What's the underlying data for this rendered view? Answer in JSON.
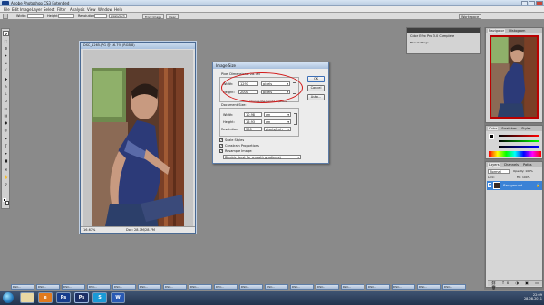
{
  "app": {
    "title": "Adobe Photoshop CS3 Extended"
  },
  "menu": [
    "File",
    "Edit",
    "Image",
    "Layer",
    "Select",
    "Filter",
    "Analysis",
    "View",
    "Window",
    "Help"
  ],
  "options": {
    "width_label": "Width:",
    "height_label": "Height:",
    "resolution_label": "Resolution:",
    "resolution_unit": "pixels/inch",
    "front_image": "Front Image",
    "clear": "Clear",
    "workspace": "Workspace"
  },
  "document": {
    "title": "DSC_1265.JPG @ 16.7% (RGB/8)",
    "zoom": "16.67%",
    "doc_size": "Doc: 28.7M/28.7M"
  },
  "dialog": {
    "title": "Image Size",
    "pixel_dimensions": "Pixel Dimensions: 28.7M",
    "width_label": "Width:",
    "width_value": "1297",
    "width_unit": "pixels",
    "height_label": "Height:",
    "height_value": "2000",
    "height_unit": "pixels",
    "document_size": "Document Size:",
    "doc_width_label": "Width:",
    "doc_width_value": "10,98",
    "doc_width_unit": "cm",
    "doc_height_label": "Height:",
    "doc_height_value": "16,93",
    "doc_height_unit": "cm",
    "resolution_label": "Resolution:",
    "resolution_value": "300",
    "resolution_unit": "pixels/inch",
    "scale_styles": "Scale Styles",
    "constrain": "Constrain Proportions",
    "resample": "Resample Image:",
    "resample_method": "Bicubic (best for smooth gradients)",
    "ok": "OK",
    "cancel": "Cancel",
    "auto": "Auto...",
    "hint": "Change the height in pixels"
  },
  "panels": {
    "navigator": [
      "Navigator",
      "Histogram"
    ],
    "color": [
      "Color",
      "Swatches",
      "Styles"
    ],
    "layers": [
      "Layers",
      "Channels",
      "Paths"
    ],
    "blend_mode": "Normal",
    "opacity": "Opacity: 100%",
    "fill": "Fill: 100%",
    "lock": "Lock:",
    "layer_name": "Background"
  },
  "float_panel": {
    "title": "Color Efex Pro 3.0 Complete",
    "item": "Filter  Settings"
  },
  "filestrip": [
    "DSC...",
    "DSC...",
    "DSC...",
    "DSC...",
    "DSC...",
    "DSC...",
    "DSC...",
    "DSC...",
    "DSC...",
    "DSC...",
    "DSC...",
    "DSC...",
    "DSC...",
    "DSC...",
    "DSC...",
    "DSC...",
    "DSC...",
    "DSC..."
  ],
  "taskbar": {
    "apps": [
      "e",
      "Ps",
      "Ps",
      "S",
      "W"
    ],
    "tray_time": "22:09",
    "tray_date": "28.08.2011"
  },
  "colors": {
    "accent": "#3d6fb6",
    "annotation": "#d21a1a",
    "layer_selected": "#3b82d6"
  }
}
